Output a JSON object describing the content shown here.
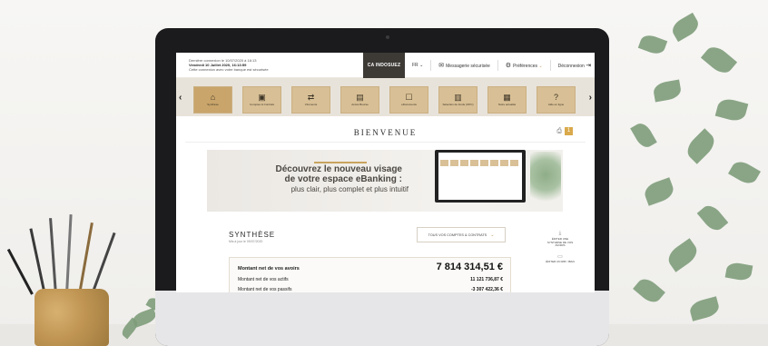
{
  "login": {
    "line1": "Dernière connexion le 10/07/2020 à 16:13",
    "line2": "Vendredi 10 Juillet 2020, 16:13:59",
    "line3": "Cette connexion avec votre banque est sécurisée"
  },
  "brand": {
    "logo_text": "CA INDOSUEZ"
  },
  "header": {
    "lang": "FR",
    "secure_messaging": "Messagerie sécurisée",
    "preferences": "Préférences",
    "logout": "Déconnexion"
  },
  "nav": {
    "tiles": [
      {
        "label": "Synthèse",
        "icon": "home-icon",
        "glyph": "⌂"
      },
      {
        "label": "Comptes & Contrats",
        "icon": "folder-icon",
        "glyph": "▣"
      },
      {
        "label": "Virements",
        "icon": "transfer-icon",
        "glyph": "⇄"
      },
      {
        "label": "Accès Bourse",
        "icon": "chart-icon",
        "glyph": "▤"
      },
      {
        "label": "eDocuments",
        "icon": "document-icon",
        "glyph": "☐"
      },
      {
        "label": "Sélection de fonds (OPC)",
        "icon": "funds-icon",
        "glyph": "▥"
      },
      {
        "label": "Notre actualité",
        "icon": "news-icon",
        "glyph": "▦"
      },
      {
        "label": "Aide en ligne",
        "icon": "help-icon",
        "glyph": "?"
      }
    ]
  },
  "welcome": {
    "title": "BIENVENUE",
    "badge": "1"
  },
  "banner": {
    "headline_1": "Découvrez le nouveau visage",
    "headline_2": "de votre espace eBanking :",
    "subline": "plus clair, plus complet et plus intuitif"
  },
  "summary": {
    "title": "SYNTHÈSE",
    "updated": "Mis à jour le 09/07/2020",
    "filter": "TOUS VOS COMPTES & CONTRATS"
  },
  "net": {
    "label": "Montant net de vos avoirs",
    "value": "7 814 314,51 €",
    "assets_label": "Montant net de vos actifs",
    "assets_value": "11 121 736,87 €",
    "liabilities_label": "Montant net de vos passifs",
    "liabilities_value": "-3 307 422,36 €"
  },
  "side_actions": [
    {
      "label": "ÉDITER UNE SYNTHÈSE DE VOS AVOIRS",
      "icon": "download-icon",
      "glyph": "⤓"
    },
    {
      "label": "ÉDITER UN RIB / IBAN",
      "icon": "card-icon",
      "glyph": "▭"
    }
  ],
  "colors": {
    "accent": "#c9a56b",
    "tile": "#d8bf95",
    "dark": "#3d3a36"
  }
}
